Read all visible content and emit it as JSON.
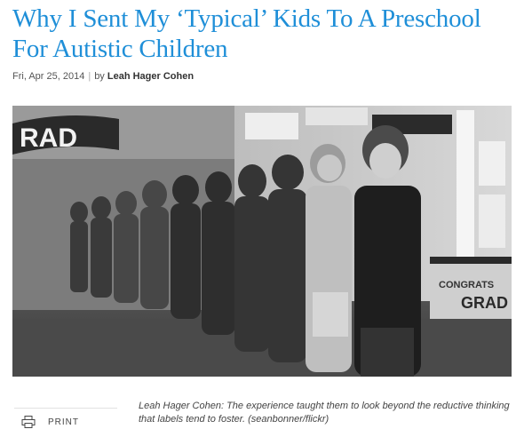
{
  "article": {
    "headline": "Why I Sent My ‘Typical’ Kids To A Preschool For Autistic Children",
    "date": "Fri, Apr 25, 2014",
    "by_prefix": "by",
    "author": "Leah Hager Cohen"
  },
  "photo": {
    "banner_text": "RAD",
    "sign_text_1": "CONGRATS",
    "sign_text_2": "GRAD"
  },
  "caption": "Leah Hager Cohen: The experience taught them to look beyond the reductive thinking that labels tend to foster. (seanbonner/flickr)",
  "toolbar": {
    "print_label": "PRINT",
    "print_icon": "printer-icon"
  }
}
